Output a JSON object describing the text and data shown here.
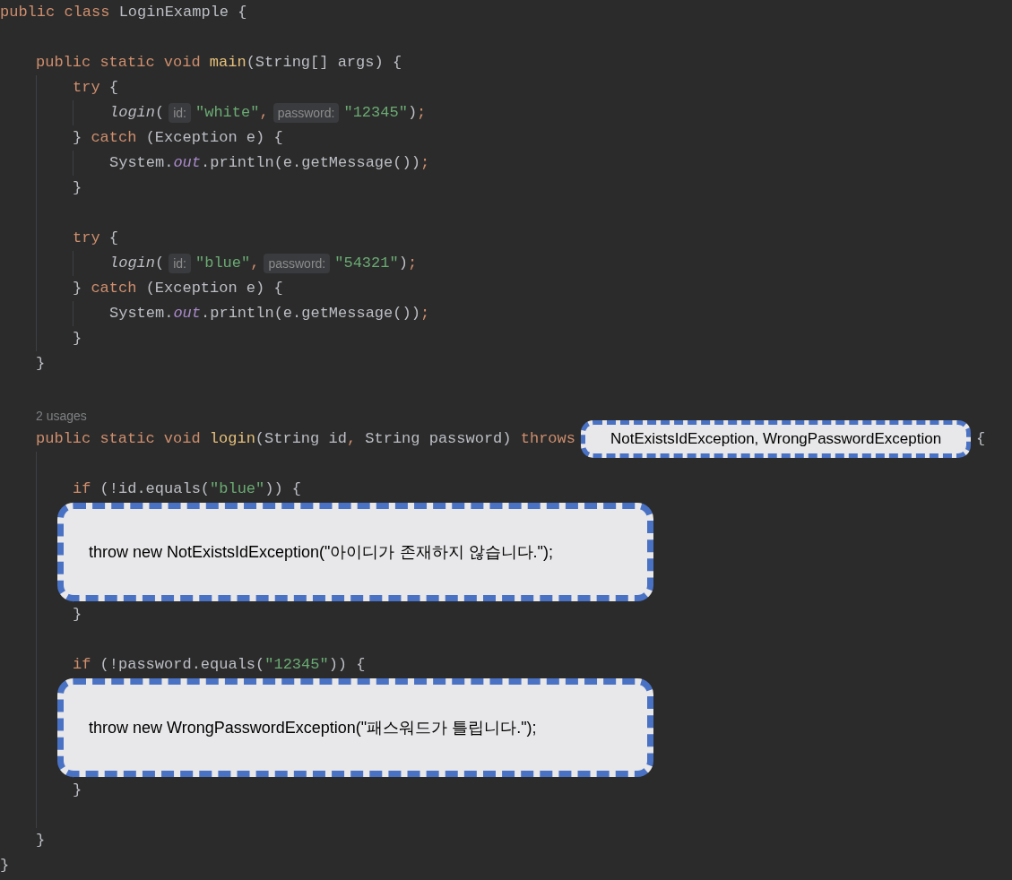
{
  "code_lines": [
    {
      "kind": "code",
      "tokens": [
        {
          "kind": "keyword",
          "text": "public class "
        },
        {
          "kind": "plain",
          "text": "LoginExample {"
        }
      ],
      "children": [
        {
          "kind": "blank"
        },
        {
          "kind": "code",
          "tokens": [
            {
              "kind": "keyword",
              "text": "public static void "
            },
            {
              "kind": "declaration",
              "text": "main"
            },
            {
              "kind": "plain",
              "text": "(String[] args) {"
            }
          ],
          "children": [
            {
              "kind": "code",
              "tokens": [
                {
                  "kind": "keyword",
                  "text": "try "
                },
                {
                  "kind": "plain",
                  "text": "{"
                }
              ],
              "children": [
                {
                  "kind": "code",
                  "tokens": [
                    {
                      "kind": "call",
                      "text": "login"
                    },
                    {
                      "kind": "plain",
                      "text": "("
                    },
                    {
                      "kind": "hint",
                      "text": "id:"
                    },
                    {
                      "kind": "string",
                      "text": "\"white\""
                    },
                    {
                      "kind": "punct",
                      "text": ","
                    },
                    {
                      "kind": "hint",
                      "text": "password:"
                    },
                    {
                      "kind": "string",
                      "text": "\"12345\""
                    },
                    {
                      "kind": "plain",
                      "text": ")"
                    },
                    {
                      "kind": "punct",
                      "text": ";"
                    }
                  ]
                }
              ]
            },
            {
              "kind": "code",
              "tokens": [
                {
                  "kind": "plain",
                  "text": "} "
                },
                {
                  "kind": "keyword",
                  "text": "catch "
                },
                {
                  "kind": "plain",
                  "text": "(Exception e) {"
                }
              ],
              "children": [
                {
                  "kind": "code",
                  "tokens": [
                    {
                      "kind": "plain",
                      "text": "System."
                    },
                    {
                      "kind": "field",
                      "text": "out"
                    },
                    {
                      "kind": "plain",
                      "text": ".println(e.getMessage())"
                    },
                    {
                      "kind": "punct",
                      "text": ";"
                    }
                  ]
                }
              ]
            },
            {
              "kind": "code",
              "tokens": [
                {
                  "kind": "plain",
                  "text": "}"
                }
              ]
            },
            {
              "kind": "blank"
            },
            {
              "kind": "code",
              "tokens": [
                {
                  "kind": "keyword",
                  "text": "try "
                },
                {
                  "kind": "plain",
                  "text": "{"
                }
              ],
              "children": [
                {
                  "kind": "code",
                  "tokens": [
                    {
                      "kind": "call",
                      "text": "login"
                    },
                    {
                      "kind": "plain",
                      "text": "("
                    },
                    {
                      "kind": "hint",
                      "text": "id:"
                    },
                    {
                      "kind": "string",
                      "text": "\"blue\""
                    },
                    {
                      "kind": "punct",
                      "text": ","
                    },
                    {
                      "kind": "hint",
                      "text": "password:"
                    },
                    {
                      "kind": "string",
                      "text": "\"54321\""
                    },
                    {
                      "kind": "plain",
                      "text": ")"
                    },
                    {
                      "kind": "punct",
                      "text": ";"
                    }
                  ]
                }
              ]
            },
            {
              "kind": "code",
              "tokens": [
                {
                  "kind": "plain",
                  "text": "} "
                },
                {
                  "kind": "keyword",
                  "text": "catch "
                },
                {
                  "kind": "plain",
                  "text": "(Exception e) {"
                }
              ],
              "children": [
                {
                  "kind": "code",
                  "tokens": [
                    {
                      "kind": "plain",
                      "text": "System."
                    },
                    {
                      "kind": "field",
                      "text": "out"
                    },
                    {
                      "kind": "plain",
                      "text": ".println(e.getMessage())"
                    },
                    {
                      "kind": "punct",
                      "text": ";"
                    }
                  ]
                }
              ]
            },
            {
              "kind": "code",
              "tokens": [
                {
                  "kind": "plain",
                  "text": "}"
                }
              ]
            }
          ]
        },
        {
          "kind": "code",
          "tokens": [
            {
              "kind": "plain",
              "text": "}"
            }
          ]
        },
        {
          "kind": "blank"
        },
        {
          "kind": "usages",
          "text": "2 usages"
        },
        {
          "kind": "code",
          "tokens": [
            {
              "kind": "keyword",
              "text": "public static void "
            },
            {
              "kind": "declaration",
              "text": "login"
            },
            {
              "kind": "plain",
              "text": "(String id"
            },
            {
              "kind": "punct",
              "text": ","
            },
            {
              "kind": "plain",
              "text": " String password) "
            },
            {
              "kind": "keyword",
              "text": "throws"
            },
            {
              "kind": "callout",
              "text": "NotExistsIdException, WrongPasswordException"
            },
            {
              "kind": "plain",
              "text": "{"
            }
          ],
          "children": [
            {
              "kind": "blank"
            },
            {
              "kind": "code",
              "tokens": [
                {
                  "kind": "keyword",
                  "text": "if "
                },
                {
                  "kind": "plain",
                  "text": "(!id.equals("
                },
                {
                  "kind": "string",
                  "text": "\"blue\""
                },
                {
                  "kind": "plain",
                  "text": ")) {"
                }
              ],
              "children": [
                {
                  "kind": "callout",
                  "text": "throw new NotExistsIdException(\"아이디가 존재하지 않습니다.\");"
                }
              ]
            },
            {
              "kind": "code",
              "tokens": [
                {
                  "kind": "plain",
                  "text": "}"
                }
              ]
            },
            {
              "kind": "blank"
            },
            {
              "kind": "code",
              "tokens": [
                {
                  "kind": "keyword",
                  "text": "if "
                },
                {
                  "kind": "plain",
                  "text": "(!password.equals("
                },
                {
                  "kind": "string",
                  "text": "\"12345\""
                },
                {
                  "kind": "plain",
                  "text": ")) {"
                }
              ],
              "children": [
                {
                  "kind": "callout",
                  "text": "throw new WrongPasswordException(\"패스워드가 틀립니다.\");"
                }
              ]
            },
            {
              "kind": "code",
              "tokens": [
                {
                  "kind": "plain",
                  "text": "}"
                }
              ]
            },
            {
              "kind": "blank"
            }
          ]
        },
        {
          "kind": "code",
          "tokens": [
            {
              "kind": "plain",
              "text": "}"
            }
          ]
        }
      ]
    },
    {
      "kind": "code",
      "tokens": [
        {
          "kind": "plain",
          "text": "}"
        }
      ]
    }
  ]
}
